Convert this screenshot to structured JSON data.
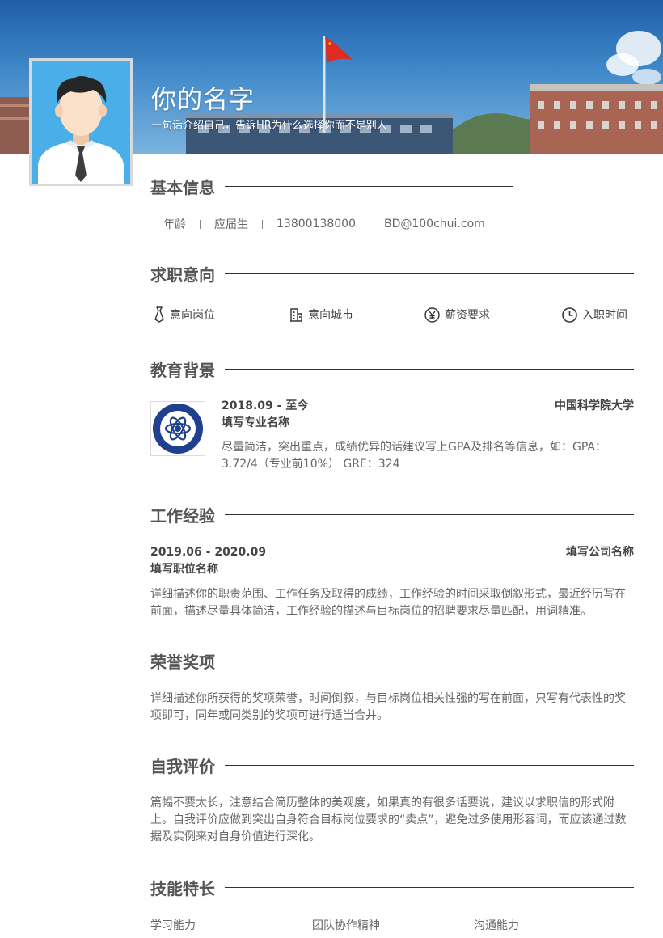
{
  "header": {
    "name": "你的名字",
    "tagline": "一句话介绍自己，告诉HR为什么选择你而不是别人"
  },
  "sections": {
    "basic": "基本信息",
    "intent": "求职意向",
    "education": "教育背景",
    "work": "工作经验",
    "honors": "荣誉奖项",
    "self_eval": "自我评价",
    "skills": "技能特长"
  },
  "basic_info": {
    "age": "年龄",
    "status": "应届生",
    "phone": "13800138000",
    "email": "BD@100chui.com"
  },
  "intent": {
    "position": "意向岗位",
    "city": "意向城市",
    "salary": "薪资要求",
    "start": "入职时间"
  },
  "education": {
    "period": "2018.09 - 至今",
    "school": "中国科学院大学",
    "major": "填写专业名称",
    "desc": "尽量简洁，突出重点，成绩优异的话建议写上GPA及排名等信息，如：GPA：3.72/4（专业前10%） GRE：324"
  },
  "work": {
    "period": "2019.06 - 2020.09",
    "company": "填写公司名称",
    "position": "填写职位名称",
    "desc": "详细描述你的职责范围、工作任务及取得的成绩，工作经验的时间采取倒叙形式，最近经历写在前面，描述尽量具体简洁，工作经验的描述与目标岗位的招聘要求尽量匹配，用词精准。"
  },
  "honors": {
    "desc": "详细描述你所获得的奖项荣誉，时间倒叙，与目标岗位相关性强的写在前面，只写有代表性的奖项即可，同年或同类别的奖项可进行适当合并。"
  },
  "self_eval": {
    "desc": "篇幅不要太长，注意结合简历整体的美观度，如果真的有很多话要说，建议以求职信的形式附上。自我评价应做到突出自身符合目标岗位要求的“卖点”，避免过多使用形容词，而应该通过数据及实例来对自身价值进行深化。"
  },
  "skills": [
    "学习能力",
    "团队协作精神",
    "沟通能力"
  ],
  "icons": {
    "position": "tie-icon",
    "city": "building-icon",
    "salary": "yuan-icon",
    "start": "clock-icon"
  },
  "colors": {
    "text": "#555555",
    "line": "#333333",
    "avatar_bg": "#4aaee8"
  }
}
